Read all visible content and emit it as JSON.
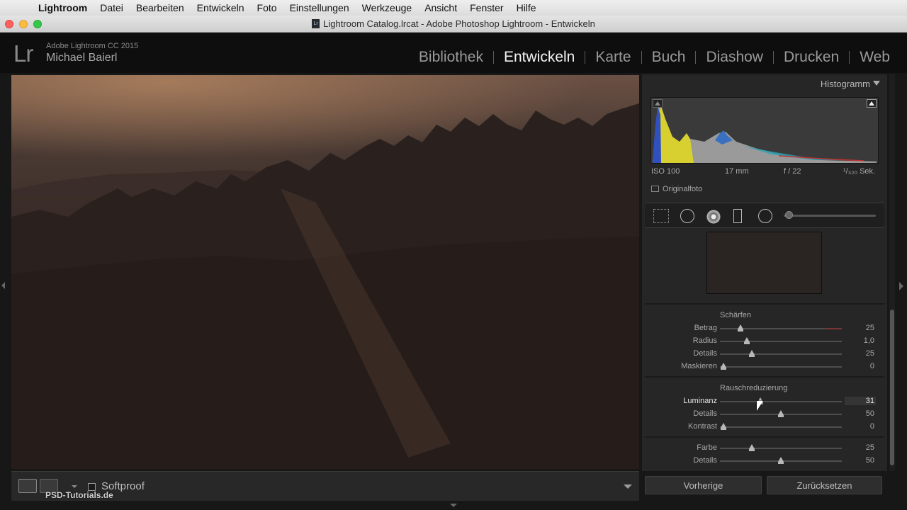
{
  "menubar": {
    "app_name": "Lightroom",
    "items": [
      "Datei",
      "Bearbeiten",
      "Entwickeln",
      "Foto",
      "Einstellungen",
      "Werkzeuge",
      "Ansicht",
      "Fenster",
      "Hilfe"
    ]
  },
  "window": {
    "title": "Lightroom Catalog.lrcat - Adobe Photoshop Lightroom - Entwickeln"
  },
  "identity": {
    "logo": "Lr",
    "version": "Adobe Lightroom CC 2015",
    "user": "Michael Baierl"
  },
  "modules": {
    "items": [
      "Bibliothek",
      "Entwickeln",
      "Karte",
      "Buch",
      "Diashow",
      "Drucken",
      "Web"
    ],
    "active": "Entwickeln"
  },
  "histogram": {
    "title": "Histogramm",
    "exif": {
      "iso": "ISO 100",
      "focal": "17 mm",
      "aperture": "f / 22",
      "shutter": "¹/₃₂₀ Sek."
    },
    "original_label": "Originalfoto"
  },
  "detail": {
    "sharpening": {
      "title": "Schärfen",
      "rows": [
        {
          "label": "Betrag",
          "value": "25",
          "pos": 0.168
        },
        {
          "label": "Radius",
          "value": "1,0",
          "pos": 0.22
        },
        {
          "label": "Details",
          "value": "25",
          "pos": 0.26
        },
        {
          "label": "Maskieren",
          "value": "0",
          "pos": 0.03
        }
      ]
    },
    "noise": {
      "title": "Rauschreduzierung",
      "luminance_rows": [
        {
          "label": "Luminanz",
          "value": "31",
          "pos": 0.33,
          "active": true
        },
        {
          "label": "Details",
          "value": "50",
          "pos": 0.5
        },
        {
          "label": "Kontrast",
          "value": "0",
          "pos": 0.03
        }
      ],
      "color_rows": [
        {
          "label": "Farbe",
          "value": "25",
          "pos": 0.26
        },
        {
          "label": "Details",
          "value": "50",
          "pos": 0.5
        }
      ]
    }
  },
  "toolbar": {
    "softproof_label": "Softproof",
    "watermark": "PSD-Tutorials.de"
  },
  "buttons": {
    "previous": "Vorherige",
    "reset": "Zurücksetzen"
  }
}
